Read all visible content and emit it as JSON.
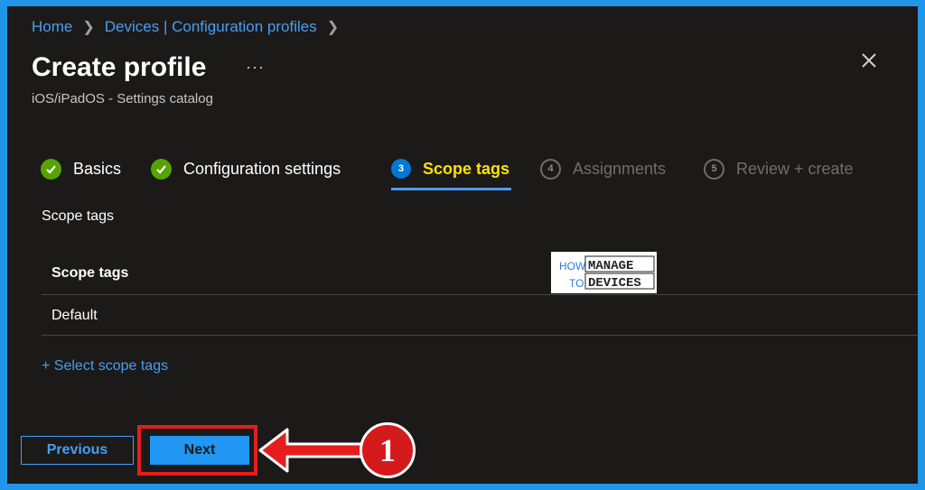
{
  "breadcrumb": {
    "home": "Home",
    "devices": "Devices | Configuration profiles"
  },
  "header": {
    "title": "Create profile",
    "more": "···",
    "subtitle": "iOS/iPadOS - Settings catalog"
  },
  "steps": [
    {
      "number": "1",
      "label": "Basics",
      "state": "done"
    },
    {
      "number": "2",
      "label": "Configuration settings",
      "state": "done"
    },
    {
      "number": "3",
      "label": "Scope tags",
      "state": "current"
    },
    {
      "number": "4",
      "label": "Assignments",
      "state": "pending"
    },
    {
      "number": "5",
      "label": "Review + create",
      "state": "pending"
    }
  ],
  "content": {
    "section_label": "Scope tags",
    "table": {
      "header": "Scope tags",
      "rows": [
        "Default"
      ]
    },
    "select_link": "+ Select scope tags"
  },
  "watermark": {
    "line1_a": "HOW",
    "line1_b": "MANAGE",
    "line2_a": "TO",
    "line2_b": "DEVICES"
  },
  "footer": {
    "previous": "Previous",
    "next": "Next"
  },
  "annotation": {
    "badge": "1"
  },
  "colors": {
    "accent": "#479ef5",
    "success": "#57a300",
    "highlight": "#e51d1d",
    "current_step": "#ffe100",
    "panel": "#1b1a19"
  },
  "icons": {
    "check": "checkmark-circle-icon",
    "close": "close-icon",
    "chevron": "chevron-right-icon",
    "arrow": "left-arrow-icon"
  }
}
